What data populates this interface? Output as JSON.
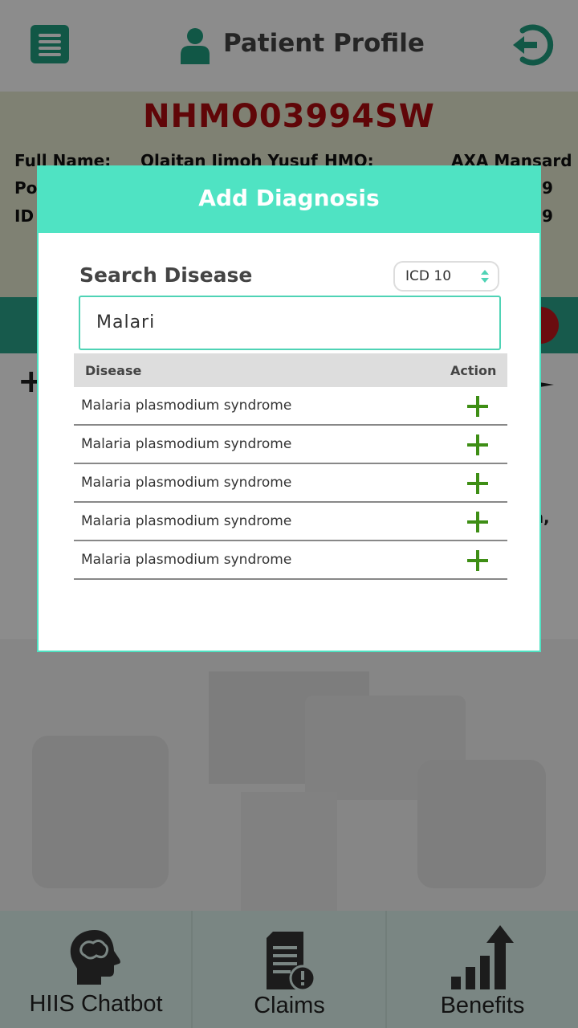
{
  "header": {
    "title": "Patient Profile"
  },
  "profile": {
    "member_id": "NHMO03994SW",
    "full_name_label": "Full Name:",
    "full_name": "Olaitan Jimoh Yusuf",
    "hmo_label": "HMO:",
    "hmo": "AXA Mansard",
    "row2_label_partial": "Pol",
    "row2_value_partial": "9",
    "row3_label_partial": "ID",
    "row3_value_partial": "9"
  },
  "content": {
    "partial_right_text": "ea,"
  },
  "bottom_nav": {
    "items": [
      {
        "label": "HIIS Chatbot",
        "icon": "brain-head-icon"
      },
      {
        "label": "Claims",
        "icon": "document-alert-icon"
      },
      {
        "label": "Benefits",
        "icon": "bar-chart-arrow-icon"
      }
    ]
  },
  "modal": {
    "title": "Add Diagnosis",
    "search_label": "Search Disease",
    "code_system": {
      "selected": "ICD 10"
    },
    "search_value": "Malari",
    "table": {
      "headers": {
        "disease": "Disease",
        "action": "Action"
      },
      "rows": [
        {
          "disease": "Malaria plasmodium syndrome"
        },
        {
          "disease": "Malaria plasmodium syndrome"
        },
        {
          "disease": "Malaria plasmodium syndrome"
        },
        {
          "disease": "Malaria plasmodium syndrome"
        },
        {
          "disease": "Malaria plasmodium syndrome"
        }
      ]
    }
  },
  "colors": {
    "accent_teal": "#4fe3c3",
    "brand_green": "#1f9e80",
    "member_id_red": "#b00c10",
    "add_green": "#3e8e15"
  }
}
